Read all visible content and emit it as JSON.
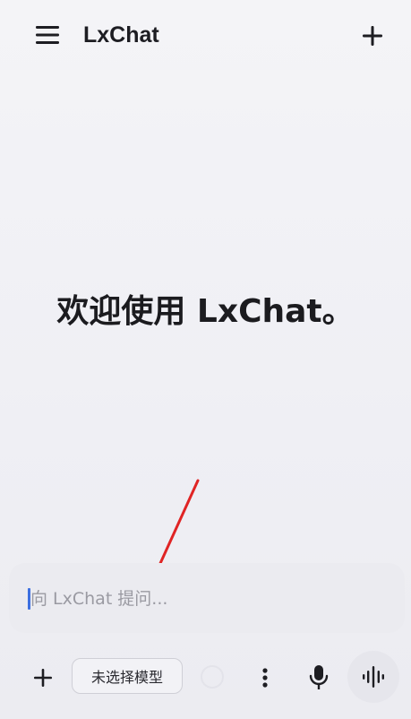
{
  "appbar": {
    "title": "LxChat",
    "menu_icon": "hamburger-menu-icon",
    "new_chat_icon": "plus-icon"
  },
  "main": {
    "welcome_text": "欢迎使用 LxChat。"
  },
  "input": {
    "placeholder": "向 LxChat 提问...",
    "value": ""
  },
  "toolbar": {
    "add_icon": "plus-icon",
    "model_label": "未选择模型",
    "status_icon": "circle-icon",
    "more_icon": "more-vertical-icon",
    "mic_icon": "microphone-icon",
    "voice_icon": "waveform-icon"
  },
  "colors": {
    "background": "#f2f2f6",
    "text_primary": "#1d1d22",
    "placeholder": "#9a9aa2",
    "caret": "#3c6fe0",
    "annotation_arrow": "#e02424"
  }
}
